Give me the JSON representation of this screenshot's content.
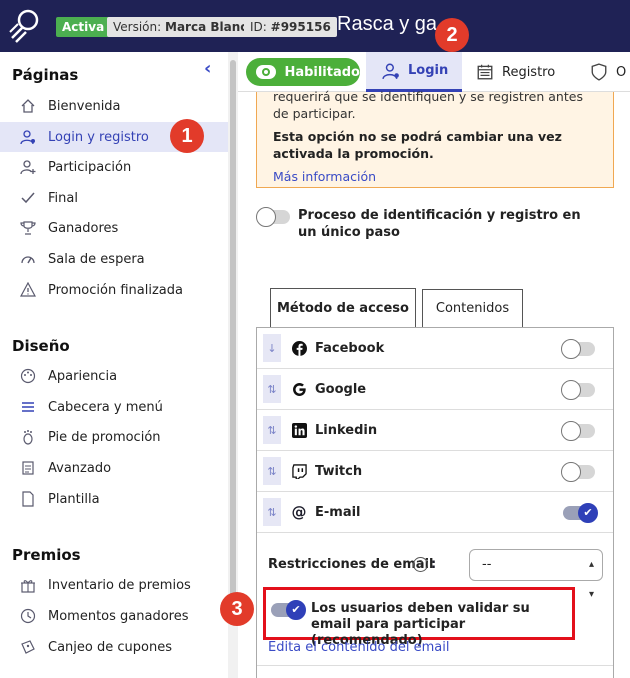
{
  "header": {
    "status": "Activa",
    "version_label": "Versión:",
    "version_value": "Marca Blanca",
    "id_label": "ID:",
    "id_value": "#995156",
    "title": "Rasca y ga"
  },
  "callouts": [
    "1",
    "2",
    "3"
  ],
  "sidebar": {
    "pages_title": "Páginas",
    "pages": [
      {
        "label": "Bienvenida",
        "icon": "home-icon"
      },
      {
        "label": "Login y registro",
        "icon": "user-login-icon"
      },
      {
        "label": "Participación",
        "icon": "user-add-icon"
      },
      {
        "label": "Final",
        "icon": "check-icon"
      },
      {
        "label": "Ganadores",
        "icon": "trophy-icon"
      },
      {
        "label": "Sala de espera",
        "icon": "gauge-icon"
      },
      {
        "label": "Promoción finalizada",
        "icon": "warning-icon"
      }
    ],
    "design_title": "Diseño",
    "design": [
      {
        "label": "Apariencia",
        "icon": "palette-icon"
      },
      {
        "label": "Cabecera y menú",
        "icon": "menu-icon"
      },
      {
        "label": "Pie de promoción",
        "icon": "foot-icon"
      },
      {
        "label": "Avanzado",
        "icon": "code-file-icon"
      },
      {
        "label": "Plantilla",
        "icon": "file-icon"
      }
    ],
    "prizes_title": "Premios",
    "prizes": [
      {
        "label": "Inventario de premios",
        "icon": "gift-icon"
      },
      {
        "label": "Momentos ganadores",
        "icon": "clock-icon"
      },
      {
        "label": "Canjeo de cupones",
        "icon": "coupon-icon"
      }
    ]
  },
  "tabs": {
    "enabled": "Habilitado",
    "login": "Login",
    "registro": "Registro",
    "more": "O"
  },
  "warning": {
    "line1": "requerirá que se identifiquen y se registren antes de participar.",
    "line2": "Esta opción no se podrá cambiar una vez activada la promoción.",
    "link": "Más información"
  },
  "process_label": "Proceso de identificación y registro en un único paso",
  "inner_tabs": {
    "access": "Método de acceso",
    "contents": "Contenidos"
  },
  "methods": [
    {
      "label": "Facebook",
      "icon": "facebook-icon",
      "handle": "↓",
      "enabled": false
    },
    {
      "label": "Google",
      "icon": "google-icon",
      "handle": "⇅",
      "enabled": false
    },
    {
      "label": "Linkedin",
      "icon": "linkedin-icon",
      "handle": "⇅",
      "enabled": false
    },
    {
      "label": "Twitch",
      "icon": "twitch-icon",
      "handle": "⇅",
      "enabled": false
    },
    {
      "label": "E-mail",
      "icon": "at-icon",
      "handle": "⇅",
      "enabled": true
    }
  ],
  "email": {
    "restrictions_label": "Restricciones de email",
    "select_value": "--",
    "validate_label": "Los usuarios deben validar su email para participar (recomendado)",
    "edit_link": "Edita el contenido del email"
  }
}
